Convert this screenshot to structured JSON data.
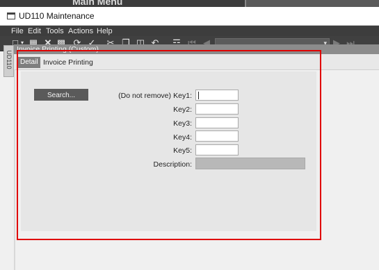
{
  "background": {
    "title": "Main Menu"
  },
  "window": {
    "title": "UD110 Maintenance"
  },
  "menu": [
    "File",
    "Edit",
    "Tools",
    "Actions",
    "Help"
  ],
  "toolbar_icons": [
    "new-icon",
    "dropdown-arrow-icon",
    "save-icon",
    "delete-icon",
    "print-icon",
    "refresh-icon",
    "clear-icon",
    "cut-icon",
    "copy-icon",
    "paste-icon",
    "undo-icon",
    "binoculars-icon",
    "first-record-icon",
    "previous-record-icon",
    "next-record-icon",
    "last-record-icon"
  ],
  "side_tab": {
    "label": "UD110"
  },
  "panel": {
    "header": "Invoice Printing (Custom)"
  },
  "tabs": {
    "detail": "Detail",
    "current": "Invoice Printing"
  },
  "form": {
    "search_button": "Search...",
    "note": "(Do not remove)",
    "key1_label": "Key1:",
    "key2_label": "Key2:",
    "key3_label": "Key3:",
    "key4_label": "Key4:",
    "key5_label": "Key5:",
    "description_label": "Description:",
    "key1_value": "",
    "key2_value": "",
    "key3_value": "",
    "key4_value": "",
    "key5_value": "",
    "description_value": ""
  },
  "colors": {
    "highlight": "#e00000",
    "menubar": "#3d3d3d",
    "panel_header": "#8c8c8c",
    "button": "#5a5a5a"
  }
}
